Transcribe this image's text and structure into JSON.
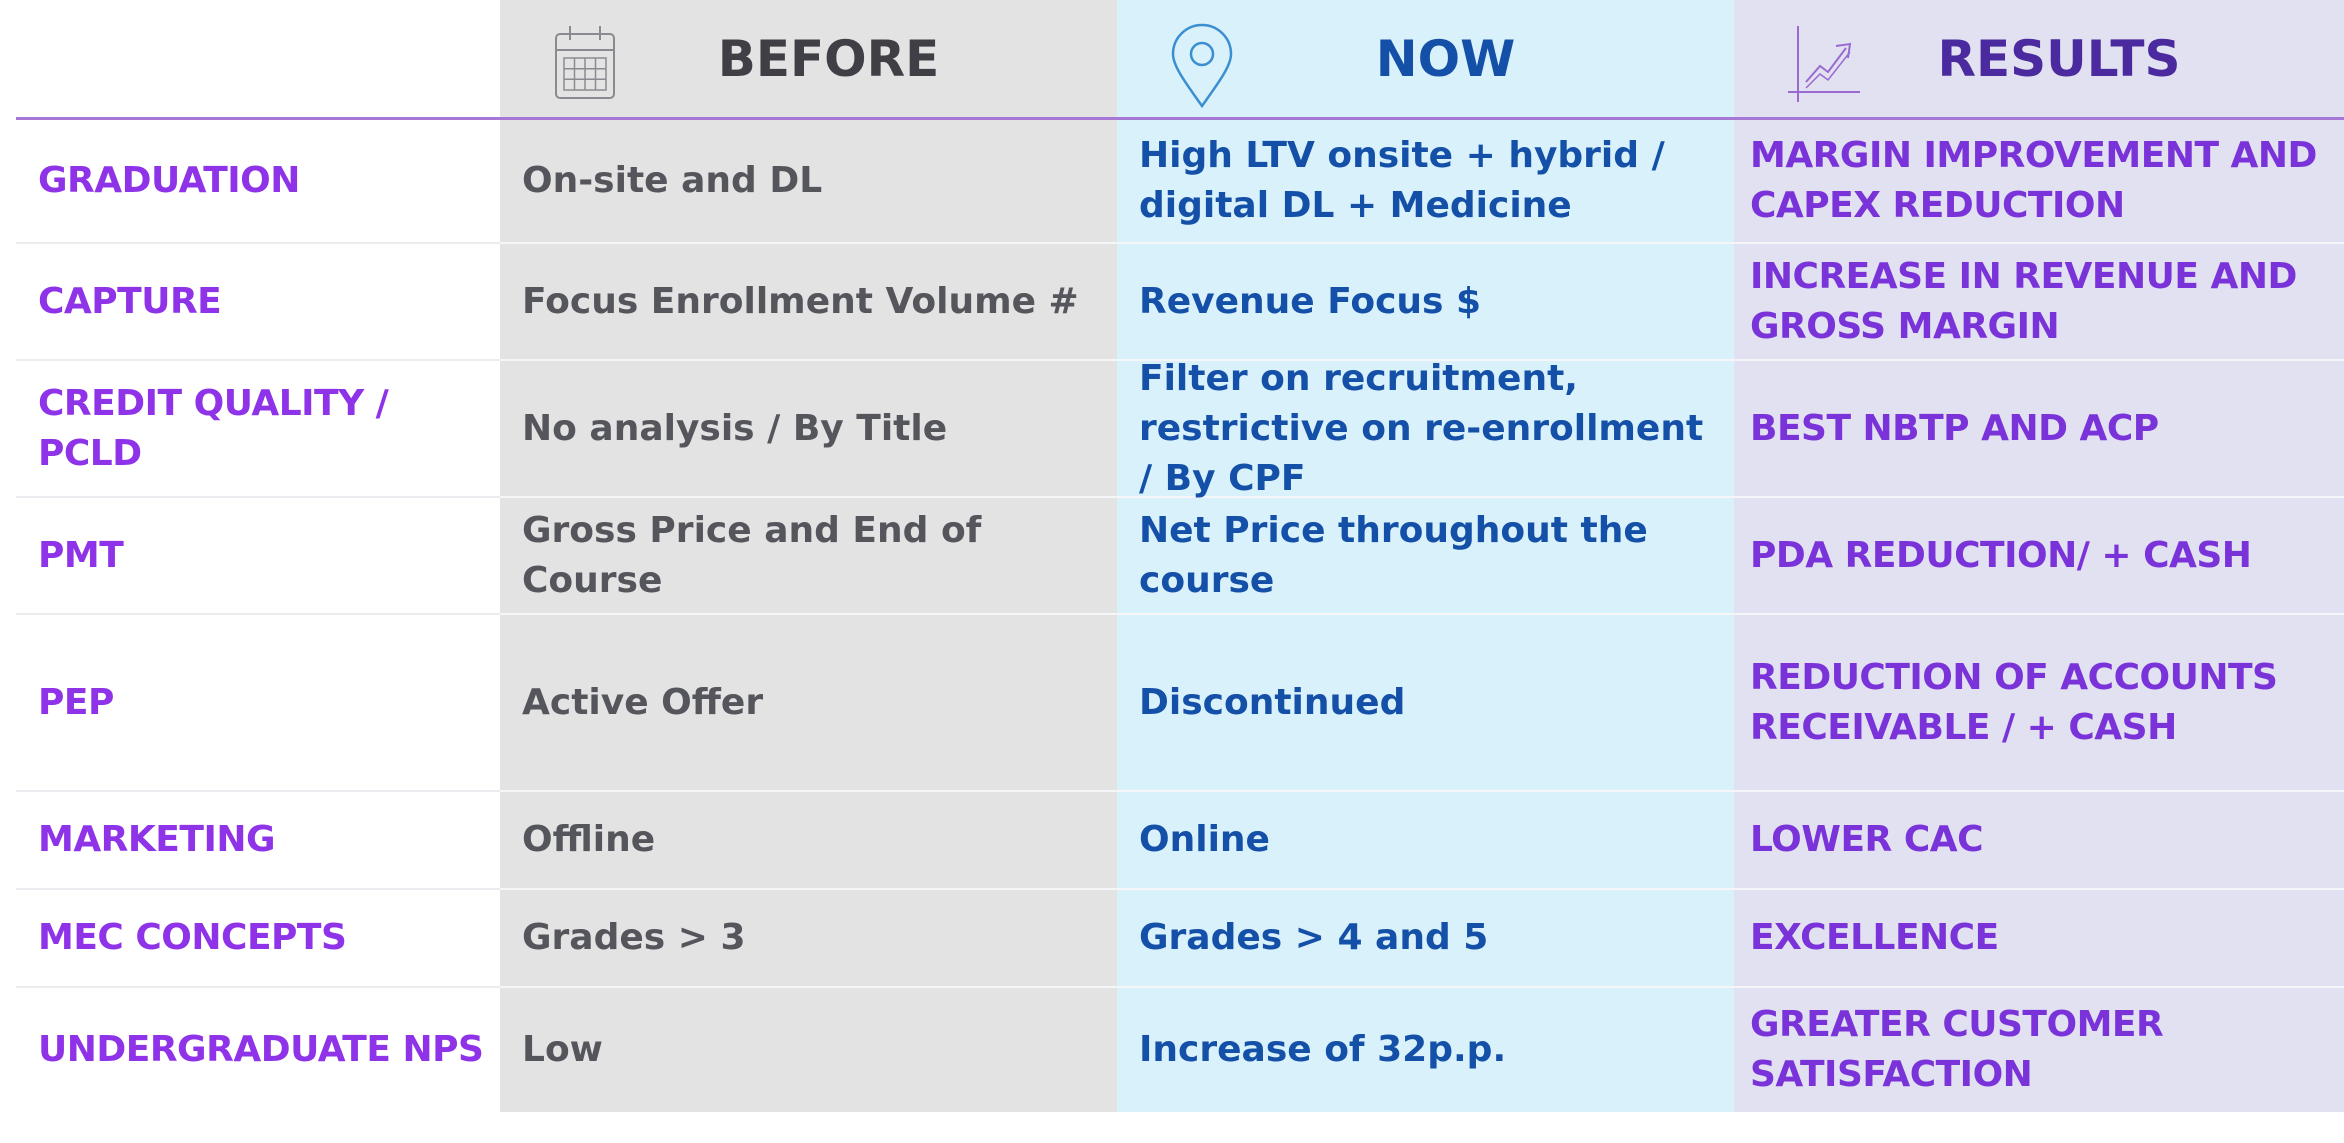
{
  "headers": {
    "before": "BEFORE",
    "now": "NOW",
    "results": "RESULTS",
    "before_icon": "calendar-icon",
    "now_icon": "location-pin-icon",
    "results_icon": "growth-chart-icon"
  },
  "rows": [
    {
      "label": "GRADUATION",
      "before": "On-site and DL",
      "now": "High LTV onsite + hybrid / digital DL + Medicine",
      "results": "MARGIN IMPROVEMENT AND CAPEX REDUCTION"
    },
    {
      "label": "CAPTURE",
      "before": "Focus Enrollment Volume #",
      "now": "Revenue Focus $",
      "results": "INCREASE IN REVENUE AND GROSS MARGIN"
    },
    {
      "label": "CREDIT QUALITY / PCLD",
      "before": "No analysis / By Title",
      "now": "Filter on recruitment, restrictive on re-enrollment / By CPF",
      "results": "BEST NBTP AND ACP"
    },
    {
      "label": "PMT",
      "before": "Gross Price and End of Course",
      "now": "Net Price throughout the course",
      "results": "PDA REDUCTION/ + CASH"
    },
    {
      "label": "PEP",
      "before": "Active Offer",
      "now": "Discontinued",
      "results": "REDUCTION OF ACCOUNTS RECEIVABLE / + CASH"
    },
    {
      "label": "MARKETING",
      "before": "Offline",
      "now": "Online",
      "results": "LOWER CAC"
    },
    {
      "label": "MEC CONCEPTS",
      "before": "Grades > 3",
      "now": "Grades >  4 and 5",
      "results": "EXCELLENCE"
    },
    {
      "label": "UNDERGRADUATE NPS",
      "before": "Low",
      "now": "Increase of 32p.p.",
      "results": "GREATER CUSTOMER SATISFACTION"
    }
  ],
  "colors": {
    "label_purple": "#8e33e8",
    "before_text": "#55555c",
    "now_blue": "#1450a8",
    "results_purple": "#7a33d8",
    "before_bg": "#e3e3e4",
    "now_bg": "#d9f1fb",
    "results_bg": "#e1e1f1"
  }
}
